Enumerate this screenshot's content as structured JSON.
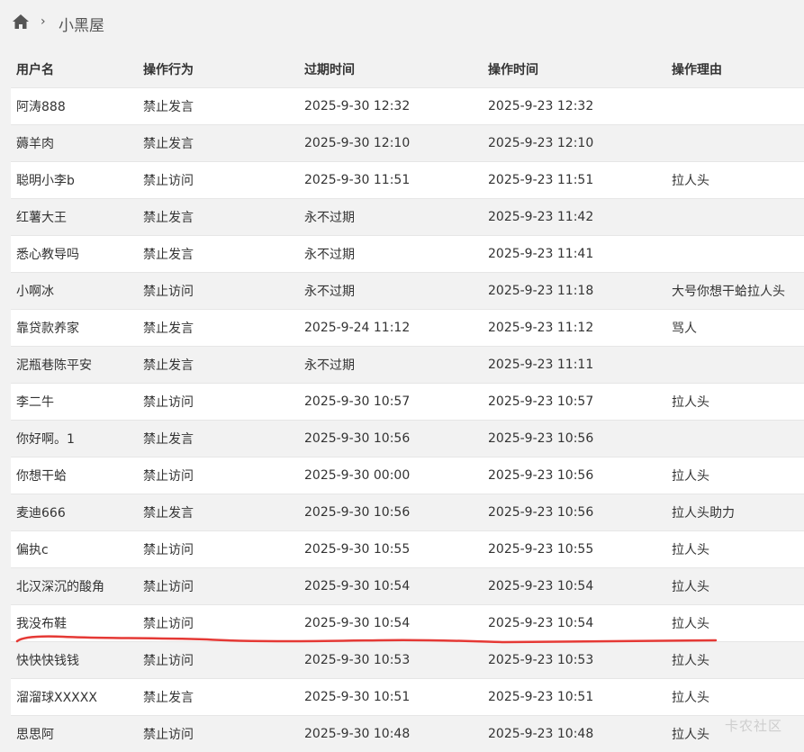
{
  "breadcrumb": {
    "home_icon": "home-icon",
    "separator": "›",
    "current": "小黑屋"
  },
  "table": {
    "headers": [
      "用户名",
      "操作行为",
      "过期时间",
      "操作时间",
      "操作理由"
    ],
    "rows": [
      [
        "阿涛888",
        "禁止发言",
        "2025-9-30 12:32",
        "2025-9-23 12:32",
        ""
      ],
      [
        "薅羊肉",
        "禁止发言",
        "2025-9-30 12:10",
        "2025-9-23 12:10",
        ""
      ],
      [
        "聪明小李b",
        "禁止访问",
        "2025-9-30 11:51",
        "2025-9-23 11:51",
        "拉人头"
      ],
      [
        "红薯大王",
        "禁止发言",
        "永不过期",
        "2025-9-23 11:42",
        ""
      ],
      [
        "悉心教导吗",
        "禁止发言",
        "永不过期",
        "2025-9-23 11:41",
        ""
      ],
      [
        "小啊冰",
        "禁止访问",
        "永不过期",
        "2025-9-23 11:18",
        "大号你想干蛤拉人头"
      ],
      [
        "靠贷款养家",
        "禁止发言",
        "2025-9-24 11:12",
        "2025-9-23 11:12",
        "骂人"
      ],
      [
        "泥瓶巷陈平安",
        "禁止发言",
        "永不过期",
        "2025-9-23 11:11",
        ""
      ],
      [
        "李二牛",
        "禁止访问",
        "2025-9-30 10:57",
        "2025-9-23 10:57",
        "拉人头"
      ],
      [
        "你好啊。1",
        "禁止发言",
        "2025-9-30 10:56",
        "2025-9-23 10:56",
        ""
      ],
      [
        "你想干蛤",
        "禁止访问",
        "2025-9-30 00:00",
        "2025-9-23 10:56",
        "拉人头"
      ],
      [
        "麦迪666",
        "禁止发言",
        "2025-9-30 10:56",
        "2025-9-23 10:56",
        "拉人头助力"
      ],
      [
        "偏执c",
        "禁止访问",
        "2025-9-30 10:55",
        "2025-9-23 10:55",
        "拉人头"
      ],
      [
        "北汉深沉的酸角",
        "禁止访问",
        "2025-9-30 10:54",
        "2025-9-23 10:54",
        "拉人头"
      ],
      [
        "我没布鞋",
        "禁止访问",
        "2025-9-30 10:54",
        "2025-9-23 10:54",
        "拉人头"
      ],
      [
        "快快快钱钱",
        "禁止访问",
        "2025-9-30 10:53",
        "2025-9-23 10:53",
        "拉人头"
      ],
      [
        "溜溜球XXXXX",
        "禁止发言",
        "2025-9-30 10:51",
        "2025-9-23 10:51",
        "拉人头"
      ],
      [
        "思思阿",
        "禁止访问",
        "2025-9-30 10:48",
        "2025-9-23 10:48",
        "拉人头"
      ]
    ]
  },
  "annotation": {
    "color": "#e53935"
  },
  "watermark": "卡农社区"
}
